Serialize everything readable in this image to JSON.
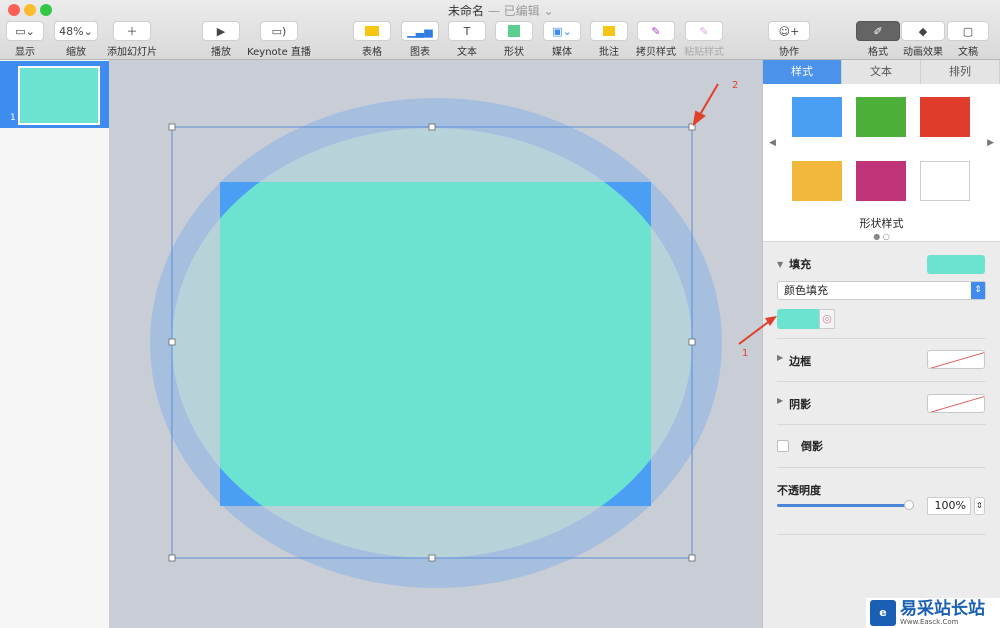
{
  "window": {
    "title": "未命名",
    "status": "— 已编辑 ⌄"
  },
  "toolbar": {
    "view": "显示",
    "zoom_value": "48%",
    "zoom": "缩放",
    "add_slide": "添加幻灯片",
    "play": "播放",
    "live": "Keynote 直播",
    "table": "表格",
    "chart": "图表",
    "text": "文本",
    "shape": "形状",
    "media": "媒体",
    "comment": "批注",
    "copy_style": "拷贝样式",
    "paste_style": "粘贴样式",
    "collaborate": "协作",
    "format": "格式",
    "animate": "动画效果",
    "document": "文稿"
  },
  "slides": [
    {
      "number": "1"
    }
  ],
  "panel": {
    "tabs": [
      "样式",
      "文本",
      "排列"
    ],
    "style_swatches": [
      "#4a9ff5",
      "#4caf3a",
      "#e03c2c",
      "#f2b83c",
      "#c0357a",
      "#ffffff"
    ],
    "shape_styles_label": "形状样式",
    "fill_label": "填充",
    "fill_color": "#6ce3d1",
    "fill_type": "颜色填充",
    "border_label": "边框",
    "shadow_label": "阴影",
    "reflection_label": "倒影",
    "opacity_label": "不透明度",
    "opacity_value": "100%",
    "opacity": 1.0
  },
  "annotations": {
    "arrow1": "1",
    "arrow2": "2"
  },
  "watermark": {
    "text": "易采站长站",
    "sub": "Www.Easck.Com"
  }
}
